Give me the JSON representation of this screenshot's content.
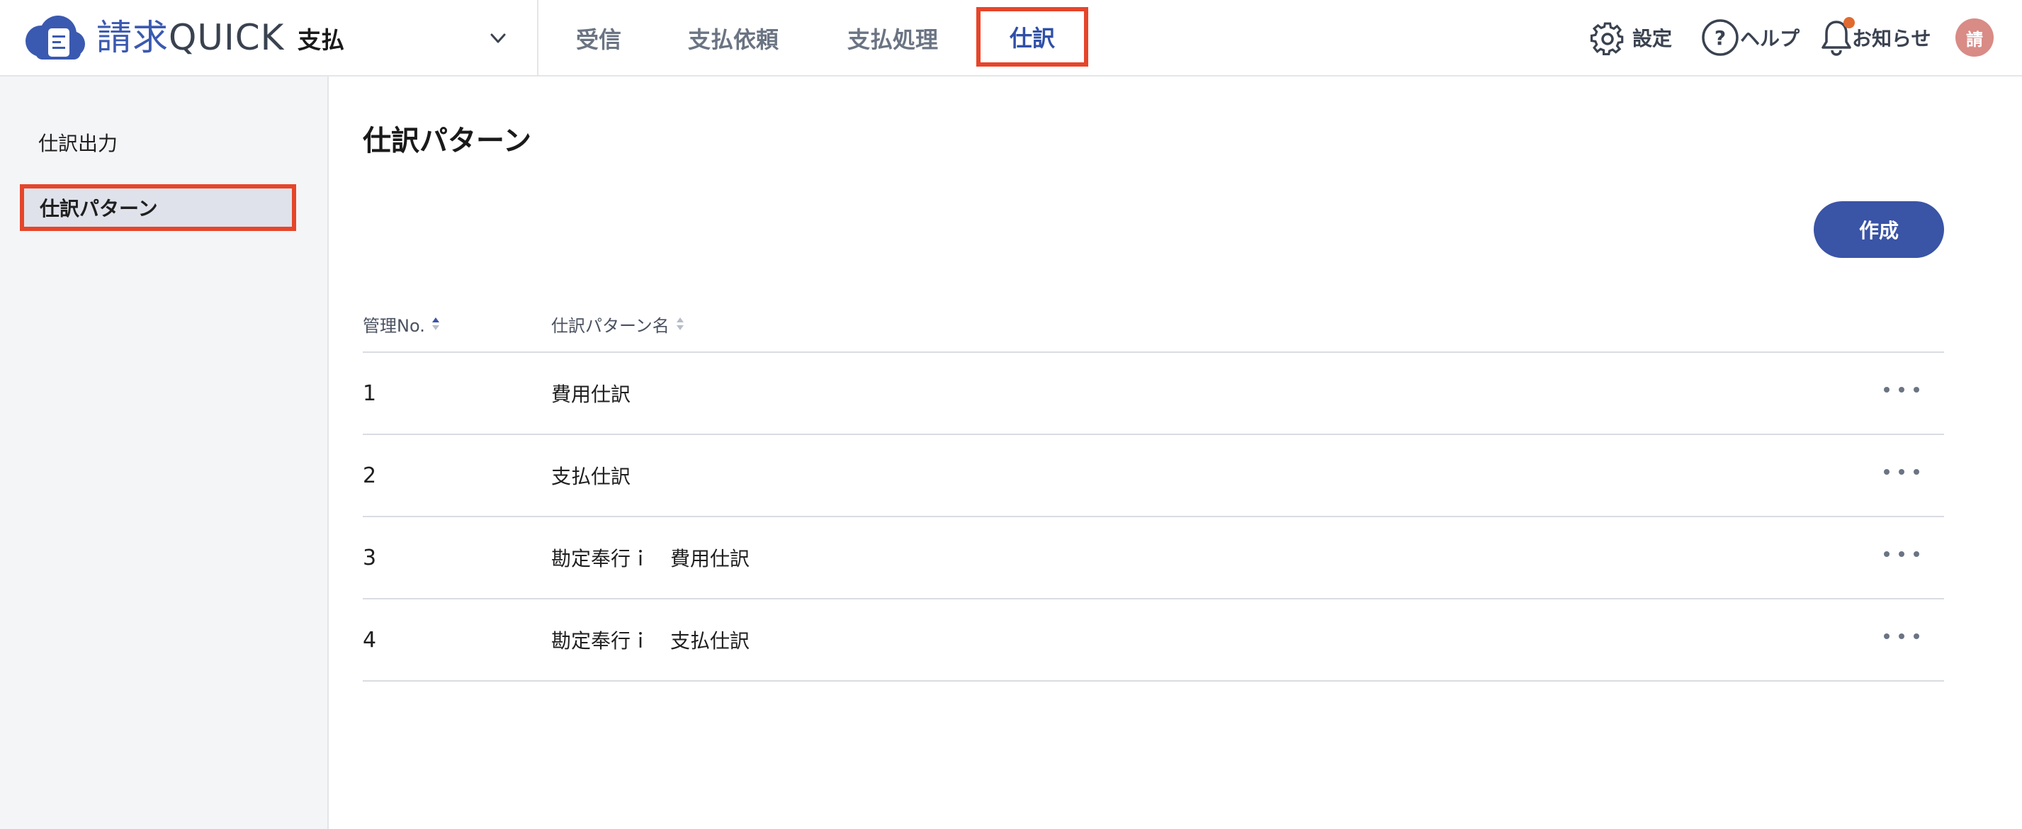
{
  "header": {
    "logo": {
      "brand_jp": "請求",
      "brand_en": "QUICK"
    },
    "app_switcher": {
      "label": "支払"
    },
    "tabs": [
      {
        "label": "受信"
      },
      {
        "label": "支払依頼"
      },
      {
        "label": "支払処理"
      },
      {
        "label": "仕訳"
      }
    ],
    "settings_label": "設定",
    "help_label": "ヘルプ",
    "notifications_label": "お知らせ",
    "avatar_text": "請"
  },
  "sidebar": {
    "items": [
      {
        "label": "仕訳出力"
      },
      {
        "label": "仕訳パターン"
      }
    ]
  },
  "main": {
    "title": "仕訳パターン",
    "create_label": "作成",
    "table": {
      "columns": [
        "管理No.",
        "仕訳パターン名"
      ],
      "rows": [
        {
          "no": "1",
          "name": "費用仕訳"
        },
        {
          "no": "2",
          "name": "支払仕訳"
        },
        {
          "no": "3",
          "name": "勘定奉行ｉ　費用仕訳"
        },
        {
          "no": "4",
          "name": "勘定奉行ｉ　支払仕訳"
        }
      ]
    }
  },
  "colors": {
    "accent": "#3a54a6",
    "highlight_border": "#e6452a",
    "sidebar_bg": "#f4f5f7",
    "notification_dot": "#e06a2f"
  },
  "icons": [
    "cloud-logo-icon",
    "chevron-down-icon",
    "gear-icon",
    "help-icon",
    "bell-icon",
    "sort-icon",
    "more-icon"
  ]
}
